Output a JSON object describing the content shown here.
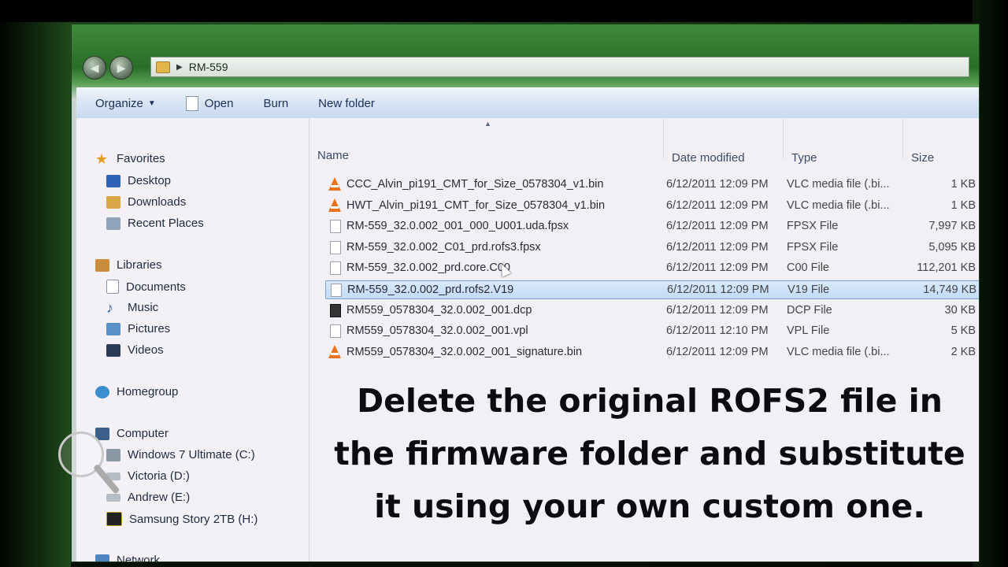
{
  "window": {
    "address_crumb": "RM-559"
  },
  "toolbar": {
    "organize": "Organize",
    "open": "Open",
    "burn": "Burn",
    "new_folder": "New folder"
  },
  "nav": {
    "favorites": "Favorites",
    "desktop": "Desktop",
    "downloads": "Downloads",
    "recent": "Recent Places",
    "libraries": "Libraries",
    "documents": "Documents",
    "music": "Music",
    "pictures": "Pictures",
    "videos": "Videos",
    "homegroup": "Homegroup",
    "computer": "Computer",
    "drive_c": "Windows 7 Ultimate (C:)",
    "drive_d": "Victoria (D:)",
    "drive_e": "Andrew (E:)",
    "drive_h": "Samsung Story 2TB (H:)",
    "network": "Network"
  },
  "columns": {
    "name": "Name",
    "date": "Date modified",
    "type": "Type",
    "size": "Size"
  },
  "files": [
    {
      "name": "CCC_Alvin_pi191_CMT_for_Size_0578304_v1.bin",
      "date": "6/12/2011 12:09 PM",
      "type": "VLC media file (.bi...",
      "size": "1 KB",
      "icon": "vlc-icon"
    },
    {
      "name": "HWT_Alvin_pi191_CMT_for_Size_0578304_v1.bin",
      "date": "6/12/2011 12:09 PM",
      "type": "VLC media file (.bi...",
      "size": "1 KB",
      "icon": "vlc-icon"
    },
    {
      "name": "RM-559_32.0.002_001_000_U001.uda.fpsx",
      "date": "6/12/2011 12:09 PM",
      "type": "FPSX File",
      "size": "7,997 KB",
      "icon": "file-icon"
    },
    {
      "name": "RM-559_32.0.002_C01_prd.rofs3.fpsx",
      "date": "6/12/2011 12:09 PM",
      "type": "FPSX File",
      "size": "5,095 KB",
      "icon": "file-icon"
    },
    {
      "name": "RM-559_32.0.002_prd.core.C00",
      "date": "6/12/2011 12:09 PM",
      "type": "C00 File",
      "size": "112,201 KB",
      "icon": "file-icon"
    },
    {
      "name": "RM-559_32.0.002_prd.rofs2.V19",
      "date": "6/12/2011 12:09 PM",
      "type": "V19 File",
      "size": "14,749 KB",
      "icon": "file-icon",
      "selected": true
    },
    {
      "name": "RM559_0578304_32.0.002_001.dcp",
      "date": "6/12/2011 12:09 PM",
      "type": "DCP File",
      "size": "30 KB",
      "icon": "dcp-icon"
    },
    {
      "name": "RM559_0578304_32.0.002_001.vpl",
      "date": "6/12/2011 12:10 PM",
      "type": "VPL File",
      "size": "5 KB",
      "icon": "file-icon"
    },
    {
      "name": "RM559_0578304_32.0.002_001_signature.bin",
      "date": "6/12/2011 12:09 PM",
      "type": "VLC media file (.bi...",
      "size": "2 KB",
      "icon": "vlc-icon"
    }
  ],
  "caption": {
    "line1": "Delete the original ROFS2 file in",
    "line2": "the firmware folder and substitute",
    "line3": "it using your own custom one."
  },
  "colors": {
    "toolbar_text": "#1c2f55",
    "selection_fill": "#c3dbf7",
    "selection_border": "#7da2ce",
    "vlc_orange": "#e8731c"
  }
}
